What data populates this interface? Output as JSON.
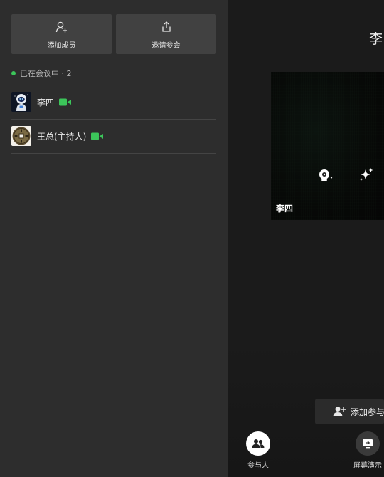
{
  "actions": {
    "add_member_label": "添加成员",
    "invite_label": "邀请参会"
  },
  "status": {
    "text": "已在会议中 · 2",
    "dot_color": "#3cc55a"
  },
  "members": [
    {
      "name": "李四",
      "avatar": "astronaut-avatar",
      "camera": "camera-on-icon"
    },
    {
      "name": "王总(主持人)",
      "avatar": "coin-avatar",
      "camera": "camera-on-icon"
    }
  ],
  "stage": {
    "title": "李",
    "video_tile": {
      "name": "李四"
    }
  },
  "add_participant_label": "添加参与",
  "bottom_bar": {
    "participants_label": "参与人",
    "screen_share_label": "屏幕演示"
  },
  "colors": {
    "panel": "#2d2d2d",
    "button": "#414141",
    "accent_green": "#3cc55a",
    "stage": "#1b1b1b"
  }
}
